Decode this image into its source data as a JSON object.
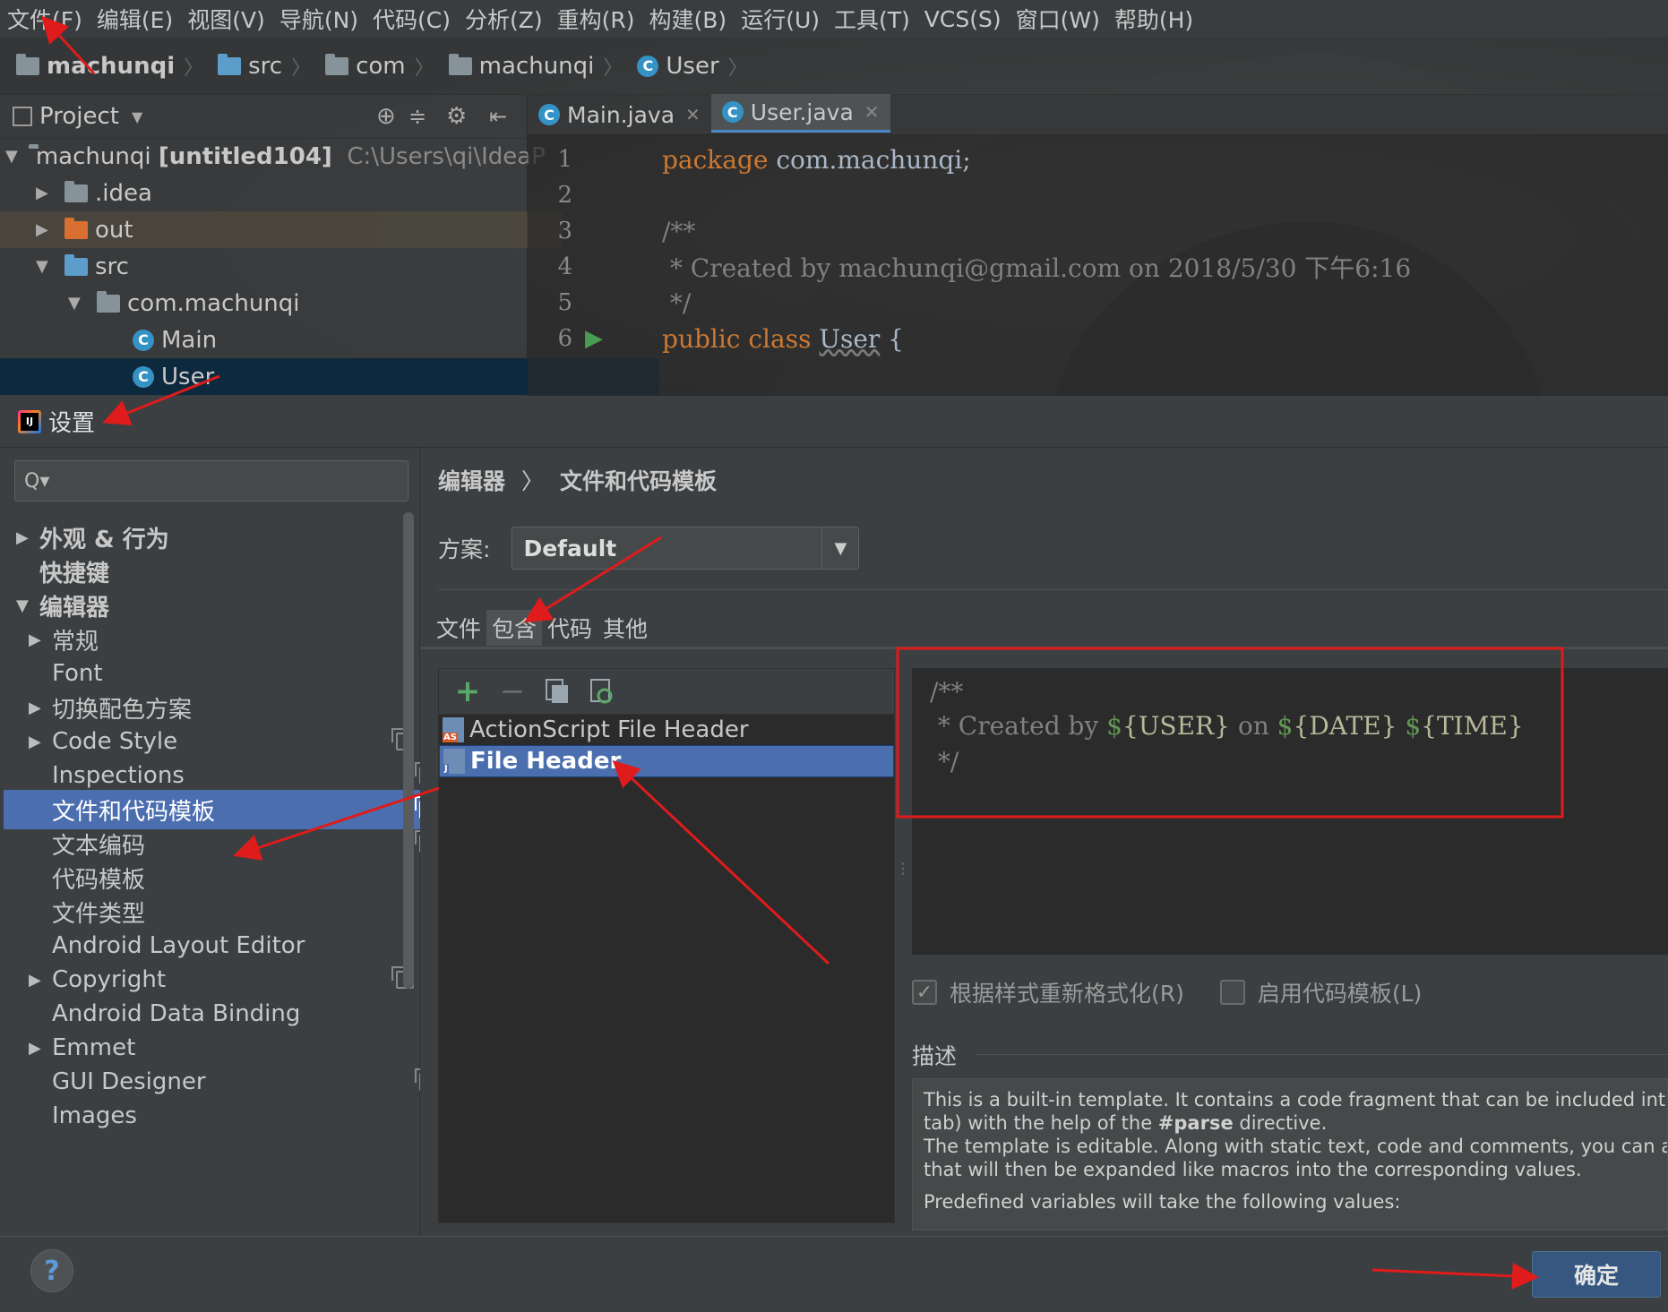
{
  "menu": [
    "文件(F)",
    "编辑(E)",
    "视图(V)",
    "导航(N)",
    "代码(C)",
    "分析(Z)",
    "重构(R)",
    "构建(B)",
    "运行(U)",
    "工具(T)",
    "VCS(S)",
    "窗口(W)",
    "帮助(H)"
  ],
  "breadcrumbs": [
    "machunqi",
    "src",
    "com",
    "machunqi",
    "User"
  ],
  "project": {
    "title": "Project",
    "tree": [
      {
        "label": "machunqi",
        "extra": "[untitled104]",
        "path": "C:\\Users\\qi\\IdeaP"
      },
      {
        "label": ".idea"
      },
      {
        "label": "out"
      },
      {
        "label": "src"
      },
      {
        "label": "com.machunqi"
      },
      {
        "label": "Main"
      },
      {
        "label": "User"
      }
    ]
  },
  "editor_tabs": [
    "Main.java",
    "User.java"
  ],
  "code": {
    "line_numbers": [
      "1",
      "2",
      "3",
      "4",
      "5",
      "6"
    ],
    "l1_kw": "package",
    "l1_rest": " com.machunqi;",
    "l3": "/**",
    "l4": " * Created by machunqi@gmail.com on 2018/5/30 下午6:16",
    "l5": " */",
    "l6_kw": "public class",
    "l6_name": "User",
    "l6_rest": " {"
  },
  "dialog": {
    "title": "设置",
    "search_placeholder": "Q▾",
    "nav": [
      {
        "label": "外观 & 行为"
      },
      {
        "label": "快捷键"
      },
      {
        "label": "编辑器"
      },
      {
        "label": "常规"
      },
      {
        "label": "Font"
      },
      {
        "label": "切换配色方案"
      },
      {
        "label": "Code Style"
      },
      {
        "label": "Inspections"
      },
      {
        "label": "文件和代码模板"
      },
      {
        "label": "文本编码"
      },
      {
        "label": "代码模板"
      },
      {
        "label": "文件类型"
      },
      {
        "label": "Android Layout Editor"
      },
      {
        "label": "Copyright"
      },
      {
        "label": "Android Data Binding"
      },
      {
        "label": "Emmet"
      },
      {
        "label": "GUI Designer"
      },
      {
        "label": "Images"
      }
    ],
    "crumb_parent": "编辑器",
    "crumb_sep": "〉",
    "crumb_current": "文件和代码模板",
    "scheme_label": "方案:",
    "scheme_value": "Default",
    "inner_tabs": [
      "文件",
      "包含",
      "代码",
      "其他"
    ],
    "templates": [
      {
        "label": "ActionScript File Header",
        "badge": "AS"
      },
      {
        "label": "File Header",
        "badge": "J"
      }
    ],
    "template_text": {
      "line1": "/**",
      "line2_prefix": " * Created by ",
      "var_user": "USER",
      "on": " on ",
      "var_date": "DATE",
      "var_time": "TIME",
      "line3": " */"
    },
    "reformat_label": "根据样式重新格式化(R)",
    "live_templates_label": "启用代码模板(L)",
    "description_label": "描述",
    "description": {
      "l1": "This is a built-in template. It contains a code fragment that can be included int",
      "l2_a": "tab) with the help of the ",
      "l2_b": "#parse",
      "l2_c": " directive.",
      "l3": "The template is editable. Along with static text, code and comments, you can a",
      "l4": "that will then be expanded like macros into the corresponding values.",
      "l5": "Predefined variables will take the following values:"
    },
    "ok_label": "确定",
    "help_label": "?"
  },
  "colors": {
    "accent": "#4b6eaf",
    "annotation_arrow": "#e01b1b",
    "highlight_box": "#e01b1b"
  }
}
